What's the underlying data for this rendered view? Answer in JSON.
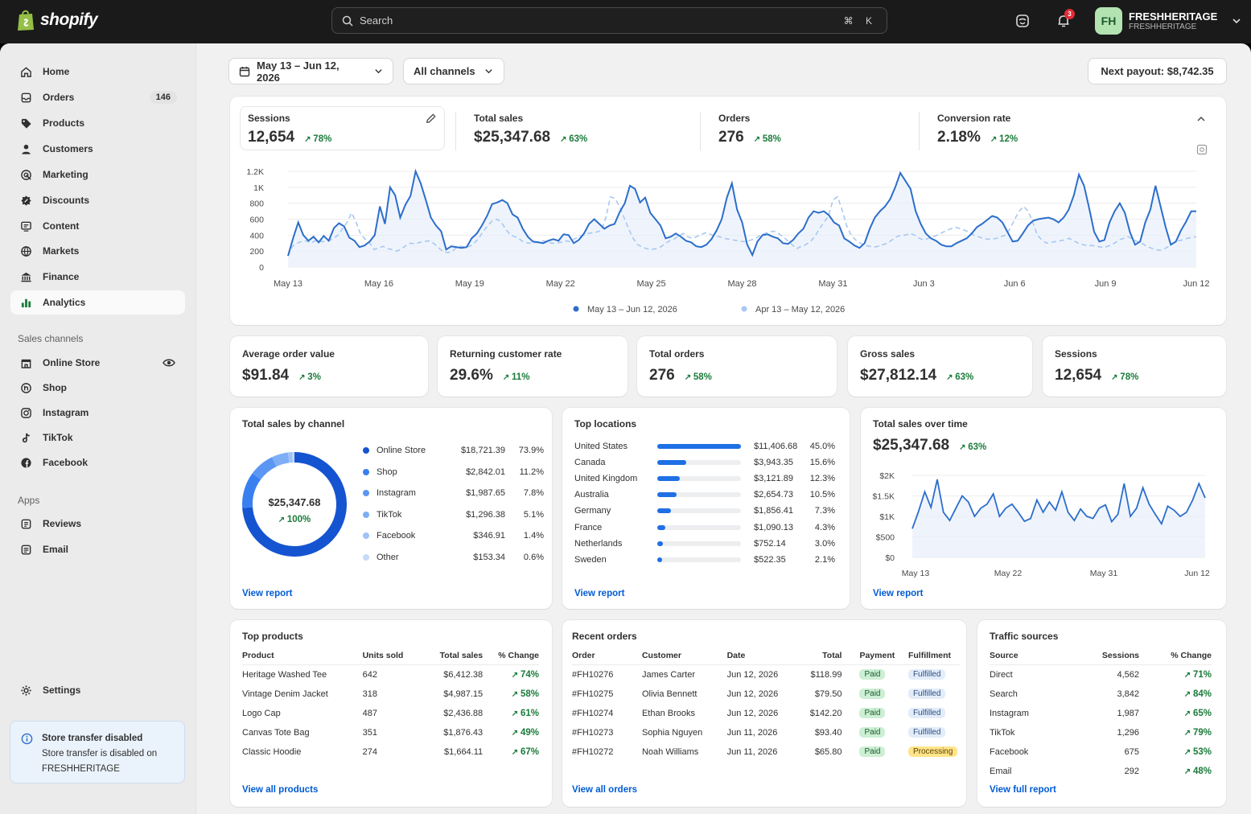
{
  "topbar": {
    "logo": "shopify",
    "search_placeholder": "Search",
    "search_shortcut": "⌘ K",
    "notifications_count": "3",
    "avatar_initials": "FH",
    "store_name": "FRESHHERITAGE",
    "store_handle": "FRESHHERITAGE"
  },
  "sidebar": {
    "items": [
      {
        "label": "Home",
        "icon": "home-icon"
      },
      {
        "label": "Orders",
        "icon": "orders-icon",
        "badge": "146"
      },
      {
        "label": "Products",
        "icon": "tag-icon"
      },
      {
        "label": "Customers",
        "icon": "person-icon"
      },
      {
        "label": "Marketing",
        "icon": "target-icon"
      },
      {
        "label": "Discounts",
        "icon": "discount-icon"
      },
      {
        "label": "Content",
        "icon": "content-icon"
      },
      {
        "label": "Markets",
        "icon": "globe-icon"
      },
      {
        "label": "Finance",
        "icon": "bank-icon"
      },
      {
        "label": "Analytics",
        "icon": "bar-chart-icon",
        "active": true
      }
    ],
    "sales_channels_heading": "Sales channels",
    "channels": [
      {
        "label": "Online Store",
        "icon": "store-icon"
      },
      {
        "label": "Shop",
        "icon": "shop-icon"
      },
      {
        "label": "Instagram",
        "icon": "instagram-icon"
      },
      {
        "label": "TikTok",
        "icon": "tiktok-icon"
      },
      {
        "label": "Facebook",
        "icon": "facebook-icon"
      }
    ],
    "apps_heading": "Apps",
    "apps": [
      {
        "label": "Reviews",
        "icon": "reviews-icon"
      },
      {
        "label": "Email",
        "icon": "email-icon"
      }
    ],
    "settings": "Settings",
    "transfer_title": "Store transfer disabled",
    "transfer_body": "Store transfer is disabled on FRESHHERITAGE"
  },
  "filters": {
    "date_range": "May 13 – Jun 12, 2026",
    "channels": "All channels",
    "payout": "Next payout: $8,742.35"
  },
  "kpis": [
    {
      "label": "Sessions",
      "value": "12,654",
      "change": "78%"
    },
    {
      "label": "Total sales",
      "value": "$25,347.68",
      "change": "63%"
    },
    {
      "label": "Orders",
      "value": "276",
      "change": "58%"
    },
    {
      "label": "Conversion rate",
      "value": "2.18%",
      "change": "12%"
    }
  ],
  "chart_data": [
    {
      "type": "line",
      "y_ticks": [
        "1.2K",
        "1K",
        "800",
        "600",
        "400",
        "200",
        "0"
      ],
      "ylim": [
        0,
        1200
      ],
      "x_ticks": [
        "May 13",
        "May 16",
        "May 19",
        "May 22",
        "May 25",
        "May 28",
        "May 31",
        "Jun 3",
        "Jun 6",
        "Jun 9",
        "Jun 12"
      ],
      "grid": true,
      "legend_position": "bottom",
      "series": [
        {
          "name": "May 13 – Jun 12, 2026",
          "color": "#2c6ecb",
          "values": [
            140,
            360,
            560,
            400,
            330,
            380,
            310,
            390,
            330,
            490,
            550,
            510,
            370,
            330,
            250,
            270,
            320,
            400,
            760,
            540,
            1000,
            900,
            620,
            780,
            890,
            1200,
            1050,
            840,
            620,
            520,
            450,
            220,
            260,
            250,
            240,
            250,
            360,
            420,
            520,
            640,
            790,
            810,
            840,
            800,
            660,
            620,
            480,
            380,
            320,
            310,
            300,
            330,
            350,
            330,
            410,
            400,
            300,
            340,
            420,
            540,
            600,
            540,
            480,
            520,
            540,
            690,
            800,
            1020,
            980,
            810,
            870,
            680,
            600,
            520,
            360,
            380,
            420,
            380,
            330,
            310,
            260,
            250,
            280,
            350,
            460,
            600,
            870,
            1050,
            720,
            560,
            280,
            150,
            320,
            400,
            410,
            380,
            360,
            300,
            290,
            340,
            420,
            480,
            620,
            700,
            680,
            700,
            650,
            560,
            520,
            360,
            320,
            270,
            240,
            300,
            480,
            620,
            700,
            760,
            850,
            1000,
            1180,
            1080,
            980,
            700,
            540,
            420,
            360,
            330,
            280,
            260,
            260,
            300,
            330,
            360,
            420,
            500,
            540,
            590,
            640,
            620,
            560,
            440,
            320,
            330,
            420,
            520,
            580,
            600,
            610,
            620,
            600,
            560,
            620,
            720,
            900,
            1160,
            1020,
            740,
            440,
            320,
            340,
            560,
            700,
            800,
            680,
            440,
            280,
            320,
            560,
            720,
            1020,
            760,
            500,
            280,
            320,
            460,
            570,
            700,
            700
          ]
        },
        {
          "name": "Apr 13 – May 12, 2026",
          "color": "#a8c8f0",
          "values": [
            140,
            260,
            300,
            320,
            330,
            300,
            330,
            320,
            320,
            330,
            360,
            400,
            480,
            560,
            680,
            560,
            410,
            350,
            300,
            220,
            240,
            260,
            230,
            220,
            200,
            230,
            270,
            300,
            290,
            310,
            320,
            330,
            300,
            250,
            200,
            180,
            190,
            240,
            260,
            250,
            260,
            300,
            360,
            450,
            520,
            580,
            600,
            560,
            470,
            400,
            380,
            350,
            310,
            300,
            300,
            320,
            330,
            320,
            300,
            300,
            310,
            330,
            320,
            350,
            380,
            400,
            420,
            430,
            440,
            460,
            620,
            880,
            860,
            760,
            620,
            480,
            360,
            280,
            250,
            230,
            220,
            230,
            250,
            290,
            330,
            350,
            390,
            420,
            380,
            360,
            380,
            410,
            430,
            410,
            390,
            380,
            360,
            350,
            340,
            330,
            320,
            320,
            340,
            360,
            400,
            420,
            440,
            450,
            420,
            380,
            330,
            280,
            230,
            260,
            280,
            320,
            380,
            480,
            560,
            640,
            840,
            880,
            720,
            520,
            400,
            340,
            300,
            270,
            260,
            250,
            260,
            280,
            300,
            340,
            380,
            400,
            400,
            420,
            400,
            360,
            340,
            360,
            380,
            400,
            430,
            460,
            480,
            500,
            480,
            460,
            440,
            400,
            380,
            360,
            350,
            350,
            360,
            380,
            400,
            480,
            600,
            700,
            760,
            700,
            560,
            400,
            340,
            300,
            310,
            320,
            330,
            340,
            360,
            330,
            300,
            280,
            270,
            270,
            260,
            250,
            250,
            270,
            300,
            340,
            360,
            380,
            350,
            320,
            300,
            260,
            240,
            220,
            210,
            230,
            260,
            300,
            330,
            340,
            360,
            370,
            380
          ]
        }
      ]
    },
    {
      "type": "pie",
      "center_value": "$25,347.68",
      "center_change": "100%",
      "categories": [
        "Online Store",
        "Shop",
        "Instagram",
        "TikTok",
        "Facebook",
        "Other"
      ],
      "amounts": [
        "$18,721.39",
        "$2,842.01",
        "$1,987.65",
        "$1,296.38",
        "$346.91",
        "$153.34"
      ],
      "values": [
        73.9,
        11.2,
        7.8,
        5.1,
        1.4,
        0.6
      ],
      "colors": [
        "#1554d1",
        "#3a7ff0",
        "#5b97f2",
        "#7eaef6",
        "#9fc2f8",
        "#c6daf9"
      ]
    },
    {
      "type": "bar",
      "orientation": "horizontal",
      "categories": [
        "United States",
        "Canada",
        "United Kingdom",
        "Australia",
        "Germany",
        "France",
        "Netherlands",
        "Sweden"
      ],
      "amounts": [
        "$11,406.68",
        "$3,943.35",
        "$3,121.89",
        "$2,654.73",
        "$1,856.41",
        "$1,090.13",
        "$752.14",
        "$522.35"
      ],
      "values": [
        45.0,
        15.6,
        12.3,
        10.5,
        7.3,
        4.3,
        3.0,
        2.1
      ],
      "labels": [
        "45.0%",
        "15.6%",
        "12.3%",
        "10.5%",
        "7.3%",
        "4.3%",
        "3.0%",
        "2.1%"
      ]
    },
    {
      "type": "line",
      "y_ticks": [
        "$2K",
        "$1.5K",
        "$1K",
        "$500",
        "$0"
      ],
      "ylim": [
        0,
        2000
      ],
      "x_ticks": [
        "May 13",
        "May 22",
        "May 31",
        "Jun 12"
      ],
      "series": [
        {
          "color": "#2c6ecb",
          "values": [
            700,
            1120,
            1600,
            1220,
            1900,
            1100,
            900,
            1200,
            1500,
            1350,
            1000,
            1200,
            1300,
            1550,
            1000,
            1200,
            1300,
            1100,
            880,
            950,
            1400,
            1100,
            1350,
            1150,
            1600,
            1100,
            900,
            1180,
            1000,
            950,
            1200,
            1280,
            870,
            1050,
            1800,
            1000,
            1200,
            1700,
            1300,
            1050,
            820,
            1250,
            1150,
            1000,
            1100,
            1400,
            1800,
            1450
          ]
        }
      ]
    }
  ],
  "sales_over_time": {
    "title": "Total sales over time",
    "value": "$25,347.68",
    "change": "63%"
  },
  "mini_kpis": [
    {
      "label": "Average order value",
      "value": "$91.84",
      "change": "3%"
    },
    {
      "label": "Returning customer rate",
      "value": "29.6%",
      "change": "11%"
    },
    {
      "label": "Total orders",
      "value": "276",
      "change": "58%"
    },
    {
      "label": "Gross sales",
      "value": "$27,812.14",
      "change": "63%"
    },
    {
      "label": "Sessions",
      "value": "12,654",
      "change": "78%"
    }
  ],
  "channels_card": {
    "title": "Total sales by channel",
    "link": "View report"
  },
  "locations_card": {
    "title": "Top locations",
    "link": "View report"
  },
  "sales_time_card": {
    "link": "View report"
  },
  "top_products": {
    "title": "Top products",
    "columns": [
      "Product",
      "Units sold",
      "Total sales",
      "% Change"
    ],
    "rows": [
      [
        "Heritage Washed Tee",
        "642",
        "$6,412.38",
        "74%"
      ],
      [
        "Vintage Denim Jacket",
        "318",
        "$4,987.15",
        "58%"
      ],
      [
        "Logo Cap",
        "487",
        "$2,436.88",
        "61%"
      ],
      [
        "Canvas Tote Bag",
        "351",
        "$1,876.43",
        "49%"
      ],
      [
        "Classic Hoodie",
        "274",
        "$1,664.11",
        "67%"
      ]
    ],
    "link": "View all products"
  },
  "recent_orders": {
    "title": "Recent orders",
    "columns": [
      "Order",
      "Customer",
      "Date",
      "Total",
      "Payment",
      "Fulfillment"
    ],
    "rows": [
      [
        "#FH10276",
        "James Carter",
        "Jun 12, 2026",
        "$118.99",
        "Paid",
        "Fulfilled"
      ],
      [
        "#FH10275",
        "Olivia Bennett",
        "Jun 12, 2026",
        "$79.50",
        "Paid",
        "Fulfilled"
      ],
      [
        "#FH10274",
        "Ethan Brooks",
        "Jun 12, 2026",
        "$142.20",
        "Paid",
        "Fulfilled"
      ],
      [
        "#FH10273",
        "Sophia Nguyen",
        "Jun 11, 2026",
        "$93.40",
        "Paid",
        "Fulfilled"
      ],
      [
        "#FH10272",
        "Noah Williams",
        "Jun 11, 2026",
        "$65.80",
        "Paid",
        "Processing"
      ]
    ],
    "link": "View all orders"
  },
  "traffic_sources": {
    "title": "Traffic sources",
    "columns": [
      "Source",
      "Sessions",
      "% Change"
    ],
    "rows": [
      [
        "Direct",
        "4,562",
        "71%"
      ],
      [
        "Search",
        "3,842",
        "84%"
      ],
      [
        "Instagram",
        "1,987",
        "65%"
      ],
      [
        "TikTok",
        "1,296",
        "79%"
      ],
      [
        "Facebook",
        "675",
        "53%"
      ],
      [
        "Email",
        "292",
        "48%"
      ]
    ],
    "link": "View full report"
  }
}
